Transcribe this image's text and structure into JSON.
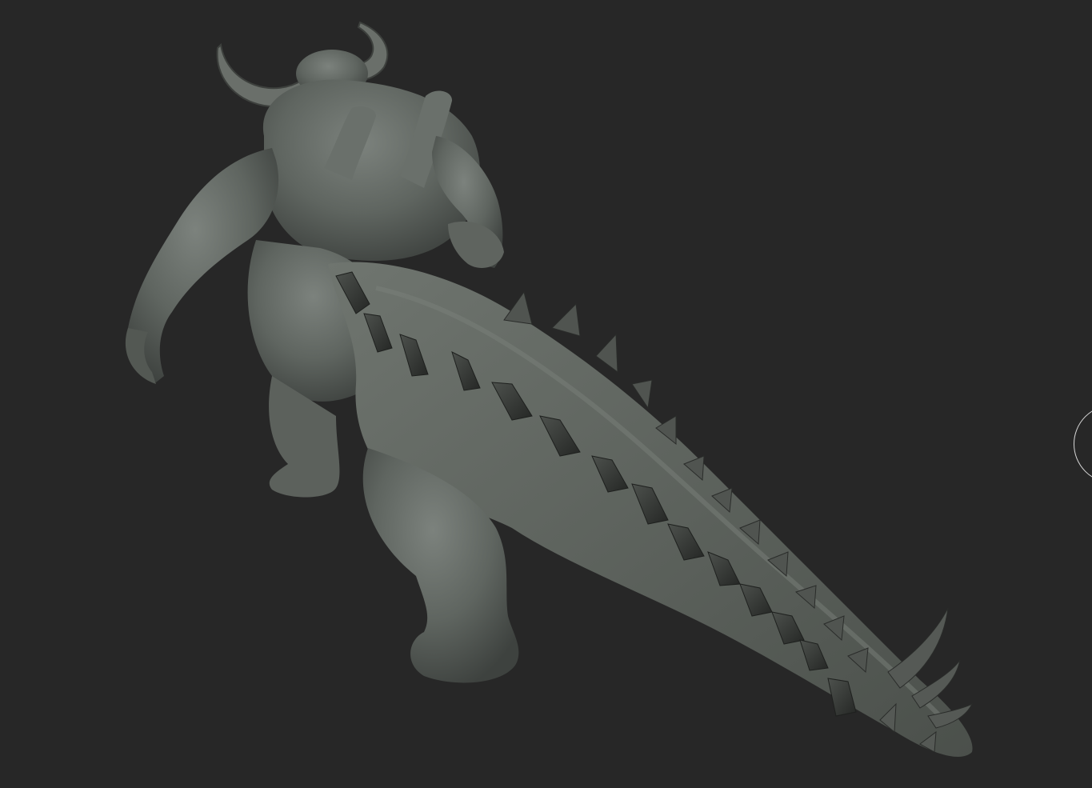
{
  "viewport": {
    "background": "#272727",
    "model_color": "#5f6560"
  },
  "gizmo": {
    "icon": "view-navigation-circle-icon"
  }
}
